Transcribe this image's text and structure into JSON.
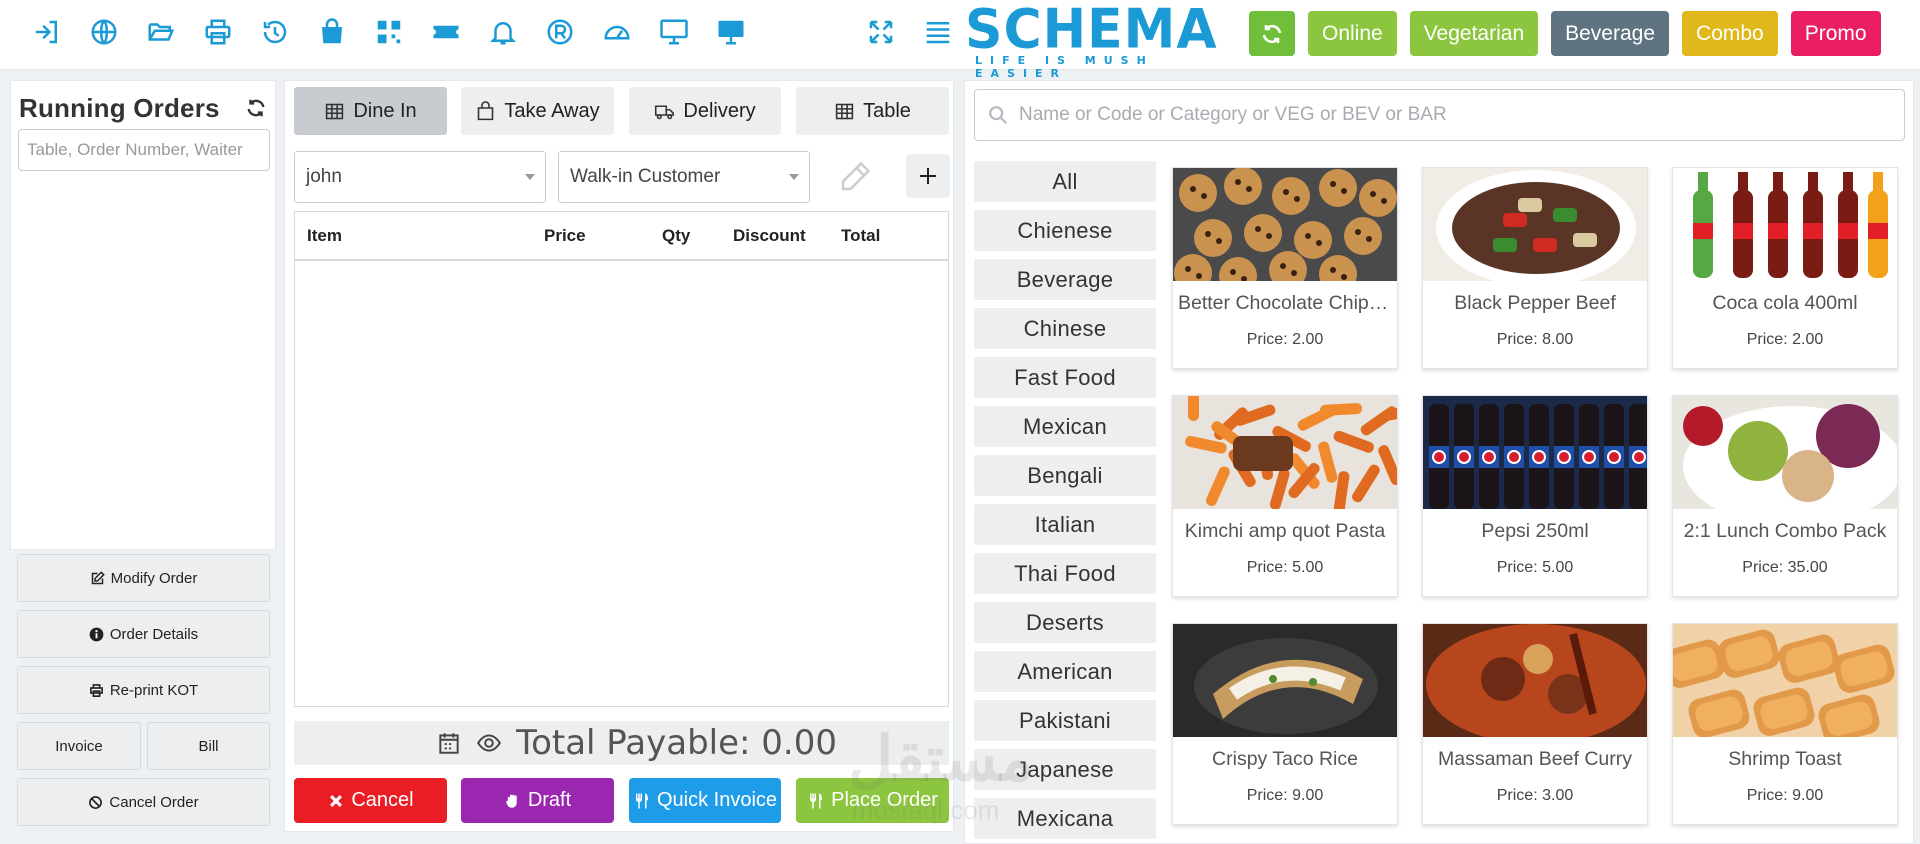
{
  "topbar": {
    "icons": [
      "logout-icon",
      "globe-icon",
      "folder-open-icon",
      "printer-icon",
      "history-icon",
      "shopping-bag-icon",
      "qrcode-icon",
      "ticket-icon",
      "bell-icon",
      "registered-icon",
      "dashboard-icon",
      "monitor-icon",
      "desktop-icon"
    ],
    "right_icons": [
      "expand-icon",
      "menu-icon"
    ],
    "logo": {
      "word": "SCHEMA",
      "tagline": "LIFE IS MUSH EASIER"
    },
    "filters": [
      {
        "label": "Online",
        "color": "#8cc63f"
      },
      {
        "label": "Vegetarian",
        "color": "#8cc63f"
      },
      {
        "label": "Beverage",
        "color": "#5f7480"
      },
      {
        "label": "Combo",
        "color": "#e0b81b"
      },
      {
        "label": "Promo",
        "color": "#ea1f63"
      }
    ]
  },
  "left": {
    "title": "Running Orders",
    "search_placeholder": "Table, Order Number, Waiter",
    "modify": "Modify Order",
    "details": "Order Details",
    "reprint": "Re-print KOT",
    "invoice": "Invoice",
    "bill": "Bill",
    "cancel": "Cancel Order"
  },
  "mid": {
    "tabs": [
      "Dine In",
      "Take Away",
      "Delivery",
      "Table"
    ],
    "waiter": "john",
    "customer": "Walk-in Customer",
    "columns": [
      "Item",
      "Price",
      "Qty",
      "Discount",
      "Total"
    ],
    "total_label": "Total Payable: 0.00",
    "actions": [
      {
        "label": "Cancel",
        "color": "#ea1d25"
      },
      {
        "label": "Draft",
        "color": "#9b27b0"
      },
      {
        "label": "Quick Invoice",
        "color": "#1e9ce8"
      },
      {
        "label": "Place Order",
        "color": "#8cc63f"
      }
    ]
  },
  "right": {
    "search_placeholder": "Name or Code or Category or VEG or BEV or BAR",
    "categories": [
      "All",
      "Chienese",
      "Beverage",
      "Chinese",
      "Fast Food",
      "Mexican",
      "Bengali",
      "Italian",
      "Thai Food",
      "Deserts",
      "American",
      "Pakistani",
      "Japanese",
      "Mexicana"
    ],
    "products": [
      {
        "name": "Better Chocolate Chip Cookies",
        "price": "Price: 2.00",
        "img": "cookies"
      },
      {
        "name": "Black Pepper Beef",
        "price": "Price: 8.00",
        "img": "beef"
      },
      {
        "name": "Coca cola 400ml",
        "price": "Price: 2.00",
        "img": "bottles"
      },
      {
        "name": "Kimchi amp quot Pasta",
        "price": "Price: 5.00",
        "img": "pasta"
      },
      {
        "name": "Pepsi 250ml",
        "price": "Price: 5.00",
        "img": "pepsi"
      },
      {
        "name": "2:1 Lunch Combo Pack",
        "price": "Price: 35.00",
        "img": "salad"
      },
      {
        "name": "Crispy Taco Rice",
        "price": "Price: 9.00",
        "img": "taco"
      },
      {
        "name": "Massaman Beef Curry",
        "price": "Price: 3.00",
        "img": "curry"
      },
      {
        "name": "Shrimp Toast",
        "price": "Price: 9.00",
        "img": "shrimp"
      }
    ]
  },
  "watermark": {
    "arabic": "مستقل",
    "url": "mostaql.com"
  }
}
